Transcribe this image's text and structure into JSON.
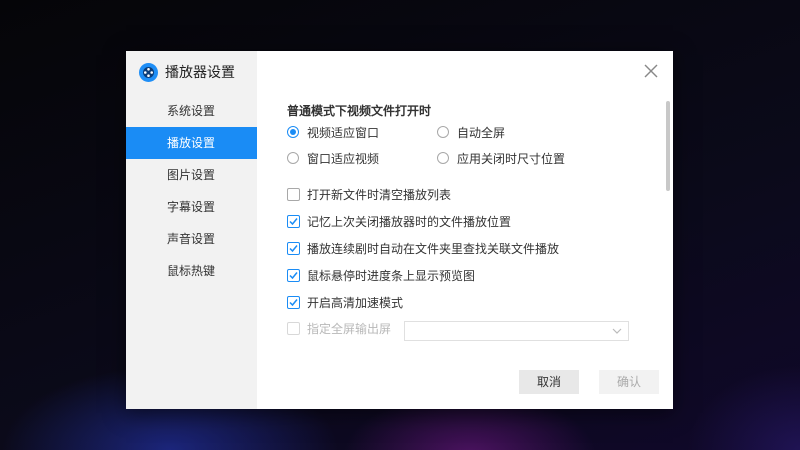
{
  "dialog": {
    "title": "播放器设置",
    "close_icon": "close-icon",
    "logo_icon": "film-reel-icon"
  },
  "sidebar": {
    "items": [
      {
        "label": "系统设置",
        "active": false
      },
      {
        "label": "播放设置",
        "active": true
      },
      {
        "label": "图片设置",
        "active": false
      },
      {
        "label": "字幕设置",
        "active": false
      },
      {
        "label": "声音设置",
        "active": false
      },
      {
        "label": "鼠标热键",
        "active": false
      }
    ]
  },
  "content": {
    "section_title": "普通模式下视频文件打开时",
    "radios": [
      {
        "label": "视频适应窗口",
        "checked": true
      },
      {
        "label": "自动全屏",
        "checked": false
      },
      {
        "label": "窗口适应视频",
        "checked": false
      },
      {
        "label": "应用关闭时尺寸位置",
        "checked": false
      }
    ],
    "checkboxes": [
      {
        "label": "打开新文件时清空播放列表",
        "checked": false
      },
      {
        "label": "记忆上次关闭播放器时的文件播放位置",
        "checked": true
      },
      {
        "label": "播放连续剧时自动在文件夹里查找关联文件播放",
        "checked": true
      },
      {
        "label": "鼠标悬停时进度条上显示预览图",
        "checked": true
      },
      {
        "label": "开启高清加速模式",
        "checked": true
      }
    ],
    "fullscreen_output": {
      "label": "指定全屏输出屏",
      "checked": false,
      "enabled": false,
      "value": ""
    }
  },
  "buttons": {
    "cancel": "取消",
    "ok": "确认"
  },
  "colors": {
    "accent": "#1a8cf5",
    "sidebar_bg": "#f2f2f2"
  }
}
